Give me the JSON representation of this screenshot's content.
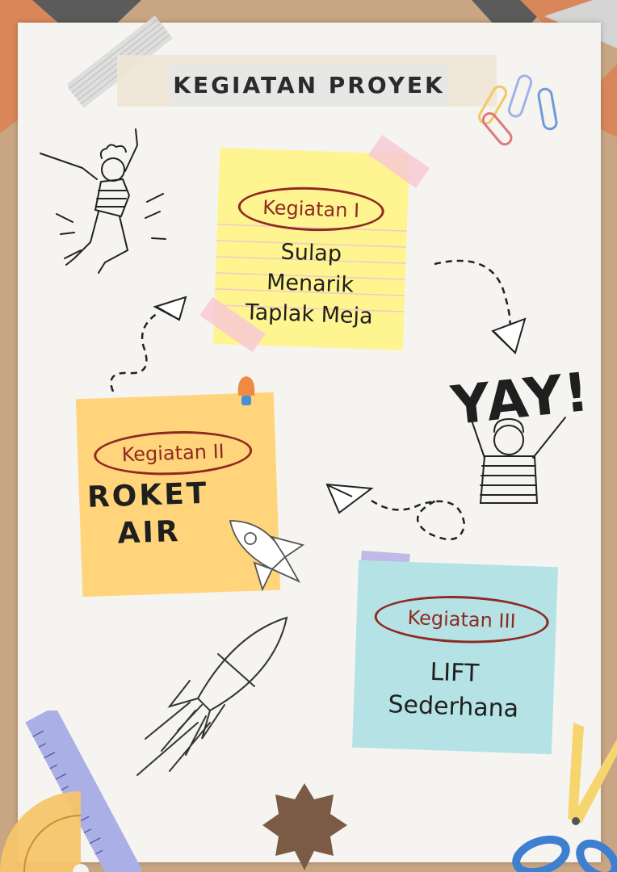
{
  "title": "KEGIATAN PROYEK",
  "notes": [
    {
      "label": "Kegiatan I",
      "text": [
        "Sulap",
        "Menarik",
        "Taplak Meja"
      ]
    },
    {
      "label": "Kegiatan II",
      "text": [
        "ROKET",
        "AIR"
      ]
    },
    {
      "label": "Kegiatan III",
      "text": [
        "LIFT",
        "Sederhana"
      ]
    }
  ],
  "yay": "YAY!",
  "colors": {
    "board": "#c8a583",
    "paper": "#f5f4f1",
    "note_yellow": "#fff590",
    "note_orange": "#ffd47b",
    "note_blue": "#b5e2e5",
    "label_ink": "#8e2a22"
  },
  "decorations": [
    "paperclip-icon",
    "paper-plane-icon",
    "rocket-icon",
    "ruler-icon",
    "protractor-icon",
    "scissors-icon",
    "pushpin-icon",
    "star-badge-icon"
  ]
}
